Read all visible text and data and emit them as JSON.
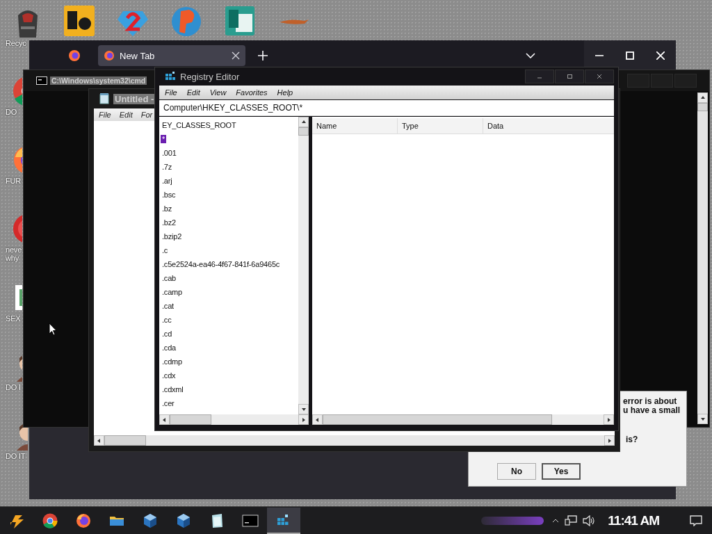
{
  "desktop": {
    "top_icons": [
      {
        "kind": "de"
      },
      {
        "kind": "two"
      },
      {
        "kind": "p"
      },
      {
        "kind": "publisher"
      },
      {
        "kind": "streak"
      }
    ],
    "side_icons": [
      {
        "kind": "recycle",
        "lines": [
          "Recyc"
        ]
      },
      {
        "kind": "chrome",
        "lines": [
          "DO"
        ]
      },
      {
        "kind": "fox",
        "lines": [
          "FUR"
        ]
      },
      {
        "kind": "redball",
        "lines": [
          "neve",
          "why"
        ]
      },
      {
        "kind": "hdoc",
        "lines": [
          "SEX"
        ]
      },
      {
        "kind": "figure",
        "lines": [
          "DO I"
        ]
      },
      {
        "kind": "figure",
        "lines": [
          "DO IT"
        ]
      }
    ]
  },
  "browser": {
    "tabs": [
      {
        "label": "New Tab",
        "selected": true
      }
    ]
  },
  "cmd": {
    "title": "C:\\Windows\\system32\\cmd"
  },
  "notepad": {
    "title": "Untitled - ",
    "menu": [
      "File",
      "Edit",
      "For"
    ]
  },
  "registry_editor": {
    "title": "Registry Editor",
    "menu": [
      "File",
      "Edit",
      "View",
      "Favorites",
      "Help"
    ],
    "address": "Computer\\HKEY_CLASSES_ROOT\\*",
    "tree": [
      {
        "label": "EY_CLASSES_ROOT",
        "selected": false
      },
      {
        "label": "*",
        "selected": true
      },
      {
        "label": ".001",
        "selected": false
      },
      {
        "label": ".7z",
        "selected": false
      },
      {
        "label": ".arj",
        "selected": false
      },
      {
        "label": ".bsc",
        "selected": false
      },
      {
        "label": ".bz",
        "selected": false
      },
      {
        "label": ".bz2",
        "selected": false
      },
      {
        "label": ".bzip2",
        "selected": false
      },
      {
        "label": ".c",
        "selected": false
      },
      {
        "label": ".c5e2524a-ea46-4f67-841f-6a9465c",
        "selected": false
      },
      {
        "label": ".cab",
        "selected": false
      },
      {
        "label": ".camp",
        "selected": false
      },
      {
        "label": ".cat",
        "selected": false
      },
      {
        "label": ".cc",
        "selected": false
      },
      {
        "label": ".cd",
        "selected": false
      },
      {
        "label": ".cda",
        "selected": false
      },
      {
        "label": ".cdmp",
        "selected": false
      },
      {
        "label": ".cdx",
        "selected": false
      },
      {
        "label": ".cdxml",
        "selected": false
      },
      {
        "label": ".cer",
        "selected": false
      }
    ],
    "columns": [
      "Name",
      "Type",
      "Data"
    ]
  },
  "dialog": {
    "lines": [
      "error is about",
      "u have a small",
      "is?"
    ],
    "buttons": [
      {
        "label": "No",
        "default": false
      },
      {
        "label": "Yes",
        "default": true
      }
    ]
  },
  "taskbar": {
    "apps": [
      {
        "kind": "start",
        "active": false
      },
      {
        "kind": "chrome",
        "active": false
      },
      {
        "kind": "fox",
        "active": false
      },
      {
        "kind": "folder",
        "active": false
      },
      {
        "kind": "cube",
        "active": false
      },
      {
        "kind": "cube",
        "active": false
      },
      {
        "kind": "notepad",
        "active": false
      },
      {
        "kind": "console",
        "active": false
      },
      {
        "kind": "registry",
        "active": true
      }
    ],
    "clock": "11:41 AM"
  }
}
